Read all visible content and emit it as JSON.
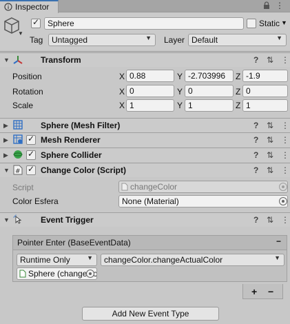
{
  "tab": {
    "label": "Inspector",
    "menu_glyph": "⋮"
  },
  "header": {
    "object_active": true,
    "object_name": "Sphere",
    "static_label": "Static",
    "static_checked": false,
    "tag_label": "Tag",
    "tag_value": "Untagged",
    "layer_label": "Layer",
    "layer_value": "Default"
  },
  "transform": {
    "title": "Transform",
    "rows": [
      {
        "label": "Position",
        "x": "0.88",
        "y": "-2.703996",
        "z": "-1.9"
      },
      {
        "label": "Rotation",
        "x": "0",
        "y": "0",
        "z": "0"
      },
      {
        "label": "Scale",
        "x": "1",
        "y": "1",
        "z": "1"
      }
    ],
    "axis": {
      "x": "X",
      "y": "Y",
      "z": "Z"
    }
  },
  "components": {
    "mesh_filter": "Sphere (Mesh Filter)",
    "mesh_renderer": "Mesh Renderer",
    "sphere_collider": "Sphere Collider",
    "change_color": "Change Color (Script)"
  },
  "change_color": {
    "script_label": "Script",
    "script_value": "changeColor",
    "color_label": "Color Esfera",
    "color_value": "None (Material)"
  },
  "event_trigger": {
    "title": "Event Trigger",
    "entry_title": "Pointer Enter (BaseEventData)",
    "remove_glyph": "−",
    "runtime_value": "Runtime Only",
    "function_value": "changeColor.changeActualColor",
    "target_value": "Sphere  (changeColor)",
    "plus": "+",
    "minus": "−",
    "add_button": "Add New Event Type"
  },
  "icons": {
    "help": "?",
    "settings": "⇅",
    "menu": "⋮"
  }
}
